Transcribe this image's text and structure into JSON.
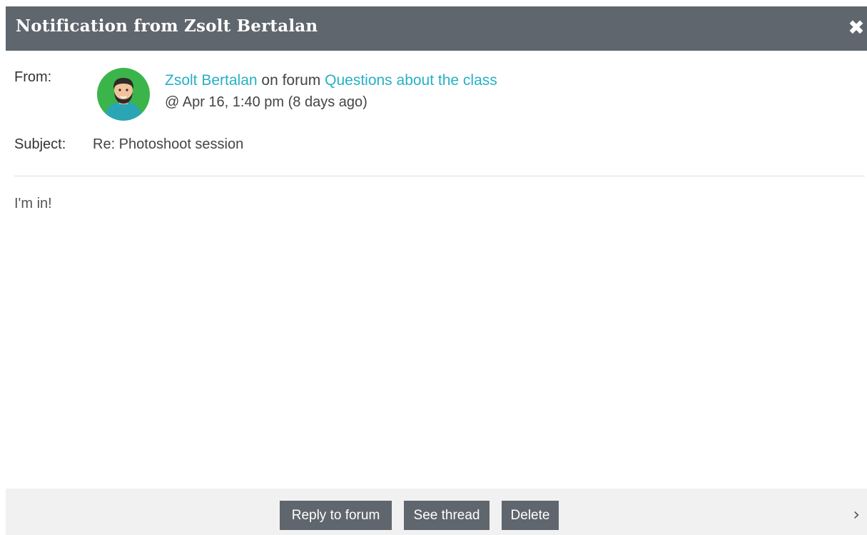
{
  "dialog": {
    "title": "Notification from Zsolt Bertalan",
    "close_icon": "close-icon"
  },
  "meta": {
    "from_label": "From:",
    "sender_name": "Zsolt Bertalan",
    "on_forum_text": "on forum",
    "forum_name": "Questions about the class",
    "date_text": "@ Apr 16, 1:40 pm (8 days ago)",
    "subject_label": "Subject:",
    "subject_value": "Re: Photoshoot session"
  },
  "message": {
    "body": "I'm in!"
  },
  "footer": {
    "reply_label": "Reply to forum",
    "thread_label": "See thread",
    "delete_label": "Delete",
    "next_icon": "chevron-right-icon"
  },
  "colors": {
    "header_bg": "#5f666d",
    "link": "#27b0c4",
    "avatar_bg": "#3bb54a",
    "button_bg": "#5f666d",
    "footer_bg": "#f1f1f1"
  }
}
